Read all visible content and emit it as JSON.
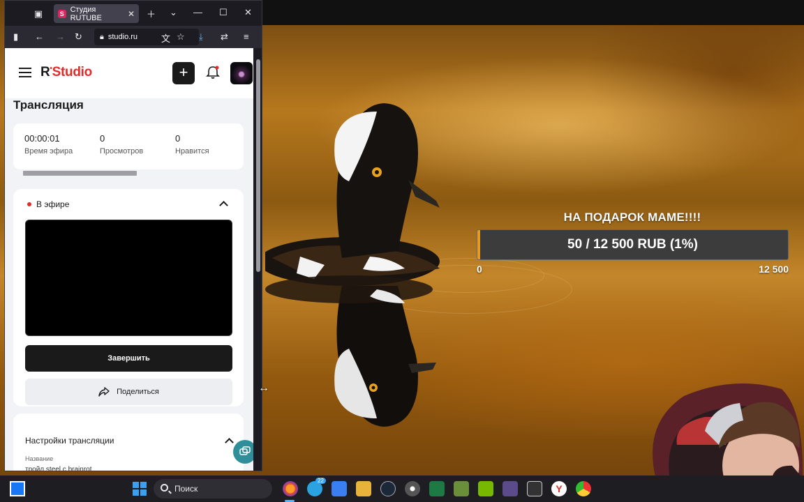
{
  "browser": {
    "tab_title": "Студия RUTUBE",
    "tab_favicon": "S",
    "url": "studio.ru"
  },
  "app": {
    "logo_r": "R",
    "logo_studio": "Studio",
    "page_title": "Трансляция",
    "stats": [
      {
        "value": "00:00:01",
        "label": "Время эфира"
      },
      {
        "value": "0",
        "label": "Просмотров"
      },
      {
        "value": "0",
        "label": "Нравится"
      }
    ],
    "live_section": {
      "status_label": "В эфире",
      "end_button": "Завершить",
      "share_button": "Поделиться"
    },
    "settings_section": {
      "title": "Настройки трансляции",
      "name_label": "Название",
      "name_value": "тройл steel с brainrot"
    }
  },
  "overlay": {
    "goal_title": "НА ПОДАРОК МАМЕ!!!!",
    "goal_text": "50 / 12 500 RUB (1%)",
    "goal_progress_percent": 1,
    "goal_min": "0",
    "goal_max": "12 500"
  },
  "taskbar": {
    "search_placeholder": "Поиск",
    "telegram_badge": "22",
    "apps": [
      "windows-start-icon",
      "firefox-icon",
      "telegram-icon",
      "app-blue-icon",
      "folder-icon",
      "steam-icon",
      "chrome-icon",
      "excel-icon",
      "minecraft-icon",
      "nvidia-icon",
      "game-icon",
      "inkscape-icon",
      "yandex-icon",
      "chrome-alt-icon"
    ]
  },
  "colors": {
    "accent_red": "#e32b2b",
    "goal_fill": "#e89a1e",
    "page_bg": "#f2f3f7"
  }
}
